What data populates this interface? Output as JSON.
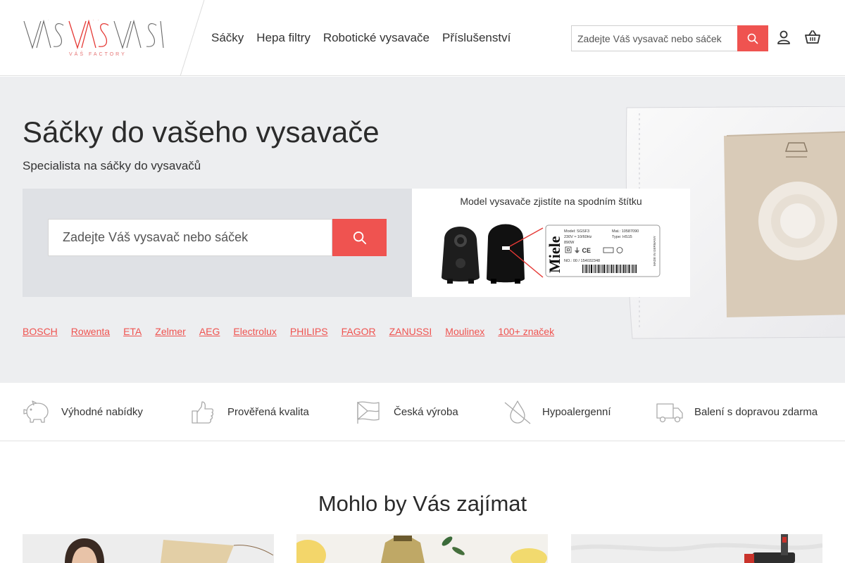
{
  "brand": {
    "logo_text": "VÁŠVAŠVÁŠ",
    "logo_tagline": "VÁŠ FACTORY",
    "accent_color": "#ef5350"
  },
  "nav": {
    "items": [
      {
        "label": "Sáčky"
      },
      {
        "label": "Hepa filtry"
      },
      {
        "label": "Robotické vysavače"
      },
      {
        "label": "Příslušenství"
      }
    ]
  },
  "header_search": {
    "placeholder": "Zadejte Váš vysavač nebo sáček",
    "button_icon": "search-icon"
  },
  "header_icons": [
    "user-icon",
    "basket-icon"
  ],
  "hero": {
    "title": "Sáčky do vašeho vysavače",
    "subtitle": "Specialista na sáčky do vysavačů",
    "search": {
      "placeholder": "Zadejte Váš vysavač nebo sáček",
      "button_icon": "search-icon"
    },
    "model_caption": "Model vysavače zjistíte na spodním štítku",
    "label_brand": "Miele",
    "label_lines": {
      "model": "Model: SGSF3",
      "mat": "Mat.: 10587090",
      "voltage": "230V ≈ 10/60Hz",
      "type": "Type: HS15",
      "power": "890W",
      "number": "NO.: 00 / 154032348",
      "made": "MADE IN GERMANY"
    },
    "brands": [
      {
        "label": "BOSCH"
      },
      {
        "label": "Rowenta"
      },
      {
        "label": "ETA"
      },
      {
        "label": "Zelmer"
      },
      {
        "label": "AEG"
      },
      {
        "label": "Electrolux"
      },
      {
        "label": "PHILIPS"
      },
      {
        "label": "FAGOR"
      },
      {
        "label": "ZANUSSI"
      },
      {
        "label": "Moulinex"
      },
      {
        "label": "100+ značek"
      }
    ]
  },
  "features": [
    {
      "label": "Výhodné nabídky",
      "icon": "piggy-bank-icon"
    },
    {
      "label": "Prověřená kvalita",
      "icon": "thumbs-up-icon"
    },
    {
      "label": "Česká výroba",
      "icon": "czech-flag-icon"
    },
    {
      "label": "Hypoalergenní",
      "icon": "no-allergen-icon"
    },
    {
      "label": "Balení s dopravou zdarma",
      "icon": "delivery-truck-icon"
    }
  ],
  "section": {
    "title": "Mohlo by Vás zajímat"
  }
}
